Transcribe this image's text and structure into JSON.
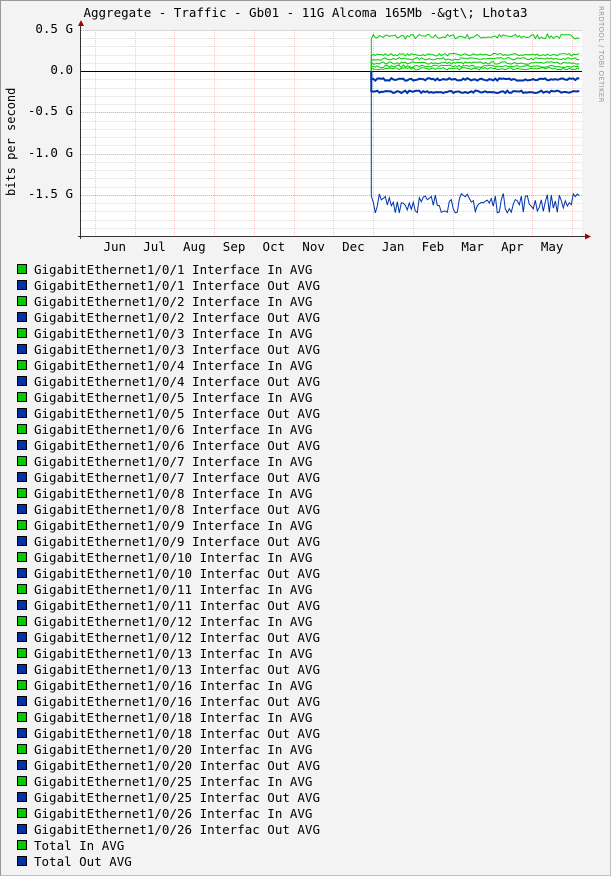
{
  "chart_data": {
    "type": "line",
    "title": "Aggregate - Traffic - Gb01 - 11G Alcoma 165Mb -&gt\\; Lhota3",
    "ylabel": "bits per second",
    "watermark": "RRDTOOL / TOBI OETIKER",
    "yticks": [
      "0.5 G",
      "0.0",
      "-0.5 G",
      "-1.0 G",
      "-1.5 G"
    ],
    "ytick_values": [
      0.5,
      0.0,
      -0.5,
      -1.0,
      -1.5
    ],
    "ylim": [
      -2.0,
      0.5
    ],
    "xticks": [
      "Jun",
      "Jul",
      "Aug",
      "Sep",
      "Oct",
      "Nov",
      "Dec",
      "Jan",
      "Feb",
      "Mar",
      "Apr",
      "May"
    ],
    "grid": true,
    "colors": {
      "in": "#00cc00",
      "out": "#0033aa"
    },
    "series": [
      {
        "name": "Total In AVG",
        "kind": "in",
        "level": 0.42
      },
      {
        "name": "GigabitEthernet1/0/1 Interface In AVG",
        "kind": "in",
        "level": 0.2
      },
      {
        "name": "GigabitEthernet1/0/2 Interface In AVG",
        "kind": "in",
        "level": 0.15
      },
      {
        "name": "GigabitEthernet1/0/3 Interface In AVG",
        "kind": "in",
        "level": 0.1
      },
      {
        "name": "GigabitEthernet1/0/4 Interface In AVG",
        "kind": "in",
        "level": 0.06
      },
      {
        "name": "GigabitEthernet1/0/5 Interface In AVG",
        "kind": "in",
        "level": 0.03
      },
      {
        "name": "GigabitEthernet1/0/6 Interface Out AVG",
        "kind": "out",
        "level": -0.1
      },
      {
        "name": "GigabitEthernet1/0/1 Interface Out AVG",
        "kind": "out",
        "level": -0.25
      },
      {
        "name": "Total Out AVG",
        "kind": "out",
        "level": -1.6
      }
    ]
  },
  "legend": [
    {
      "label": "GigabitEthernet1/0/1 Interface In AVG",
      "color": "#00cc00"
    },
    {
      "label": "GigabitEthernet1/0/1 Interface Out AVG",
      "color": "#0033aa"
    },
    {
      "label": "GigabitEthernet1/0/2 Interface In AVG",
      "color": "#00cc00"
    },
    {
      "label": "GigabitEthernet1/0/2 Interface Out AVG",
      "color": "#0033aa"
    },
    {
      "label": "GigabitEthernet1/0/3 Interface In AVG",
      "color": "#00cc00"
    },
    {
      "label": "GigabitEthernet1/0/3 Interface Out AVG",
      "color": "#0033aa"
    },
    {
      "label": "GigabitEthernet1/0/4 Interface In AVG",
      "color": "#00cc00"
    },
    {
      "label": "GigabitEthernet1/0/4 Interface Out AVG",
      "color": "#0033aa"
    },
    {
      "label": "GigabitEthernet1/0/5 Interface In AVG",
      "color": "#00cc00"
    },
    {
      "label": "GigabitEthernet1/0/5 Interface Out AVG",
      "color": "#0033aa"
    },
    {
      "label": "GigabitEthernet1/0/6 Interface In AVG",
      "color": "#00cc00"
    },
    {
      "label": "GigabitEthernet1/0/6 Interface Out AVG",
      "color": "#0033aa"
    },
    {
      "label": "GigabitEthernet1/0/7 Interface In AVG",
      "color": "#00cc00"
    },
    {
      "label": "GigabitEthernet1/0/7 Interface Out AVG",
      "color": "#0033aa"
    },
    {
      "label": "GigabitEthernet1/0/8 Interface In AVG",
      "color": "#00cc00"
    },
    {
      "label": "GigabitEthernet1/0/8 Interface Out AVG",
      "color": "#0033aa"
    },
    {
      "label": "GigabitEthernet1/0/9 Interface In AVG",
      "color": "#00cc00"
    },
    {
      "label": "GigabitEthernet1/0/9 Interface Out AVG",
      "color": "#0033aa"
    },
    {
      "label": "GigabitEthernet1/0/10 Interfac In AVG",
      "color": "#00cc00"
    },
    {
      "label": "GigabitEthernet1/0/10 Interfac Out AVG",
      "color": "#0033aa"
    },
    {
      "label": "GigabitEthernet1/0/11 Interfac In AVG",
      "color": "#00cc00"
    },
    {
      "label": "GigabitEthernet1/0/11 Interfac Out AVG",
      "color": "#0033aa"
    },
    {
      "label": "GigabitEthernet1/0/12 Interfac In AVG",
      "color": "#00cc00"
    },
    {
      "label": "GigabitEthernet1/0/12 Interfac Out AVG",
      "color": "#0033aa"
    },
    {
      "label": "GigabitEthernet1/0/13 Interfac In AVG",
      "color": "#00cc00"
    },
    {
      "label": "GigabitEthernet1/0/13 Interfac Out AVG",
      "color": "#0033aa"
    },
    {
      "label": "GigabitEthernet1/0/16 Interfac In AVG",
      "color": "#00cc00"
    },
    {
      "label": "GigabitEthernet1/0/16 Interfac Out AVG",
      "color": "#0033aa"
    },
    {
      "label": "GigabitEthernet1/0/18 Interfac In AVG",
      "color": "#00cc00"
    },
    {
      "label": "GigabitEthernet1/0/18 Interfac Out AVG",
      "color": "#0033aa"
    },
    {
      "label": "GigabitEthernet1/0/20 Interfac In AVG",
      "color": "#00cc00"
    },
    {
      "label": "GigabitEthernet1/0/20 Interfac Out AVG",
      "color": "#0033aa"
    },
    {
      "label": "GigabitEthernet1/0/25 Interfac In AVG",
      "color": "#00cc00"
    },
    {
      "label": "GigabitEthernet1/0/25 Interfac Out AVG",
      "color": "#0033aa"
    },
    {
      "label": "GigabitEthernet1/0/26 Interfac In AVG",
      "color": "#00cc00"
    },
    {
      "label": "GigabitEthernet1/0/26 Interfac Out AVG",
      "color": "#0033aa"
    },
    {
      "label": "Total In AVG",
      "color": "#00cc00"
    },
    {
      "label": "Total Out AVG",
      "color": "#0033aa"
    }
  ]
}
